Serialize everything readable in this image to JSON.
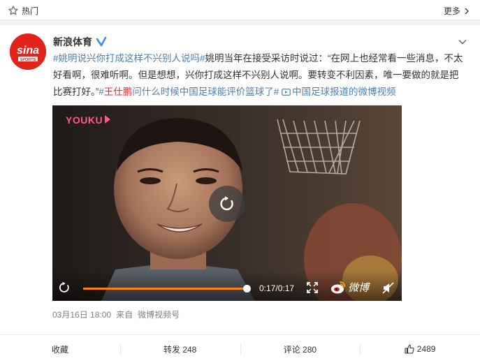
{
  "topbar": {
    "hot_label": "热门",
    "more_label": "更多"
  },
  "post": {
    "author": "新浪体育",
    "avatar_text": "sina",
    "avatar_subtext": "SPORTS",
    "text": {
      "topic1": "#姚明说兴你打成这样不兴别人说吗#",
      "body1": "姚明当年在接受采访时说过：“在网上也经常看一些消息，不太好看啊，很难听啊。但是想想，兴你打成这样不兴别人说啊。要转变不利因素，唯一要做的就是把比赛打好。”",
      "hash_open": "#",
      "mention": "王仕鹏",
      "topic2_rest": "问什么时候中国足球能评价篮球了#",
      "video_link": "中国足球报道的微博视频"
    },
    "video": {
      "watermark": "YOUKU",
      "time": "0:17/0:17",
      "progress": 1.0,
      "brand": "微博"
    },
    "meta": {
      "date": "03月16日 18:00",
      "from_label": "来自",
      "source": "微博视频号"
    },
    "actions": {
      "favorite": "收藏",
      "repost": "转发 248",
      "comment": "评论 280",
      "like": "2489"
    }
  },
  "colors": {
    "link": "#507daf",
    "mention": "#e02f2f",
    "progress": "#ff8200",
    "brand_red": "#e2231a"
  }
}
